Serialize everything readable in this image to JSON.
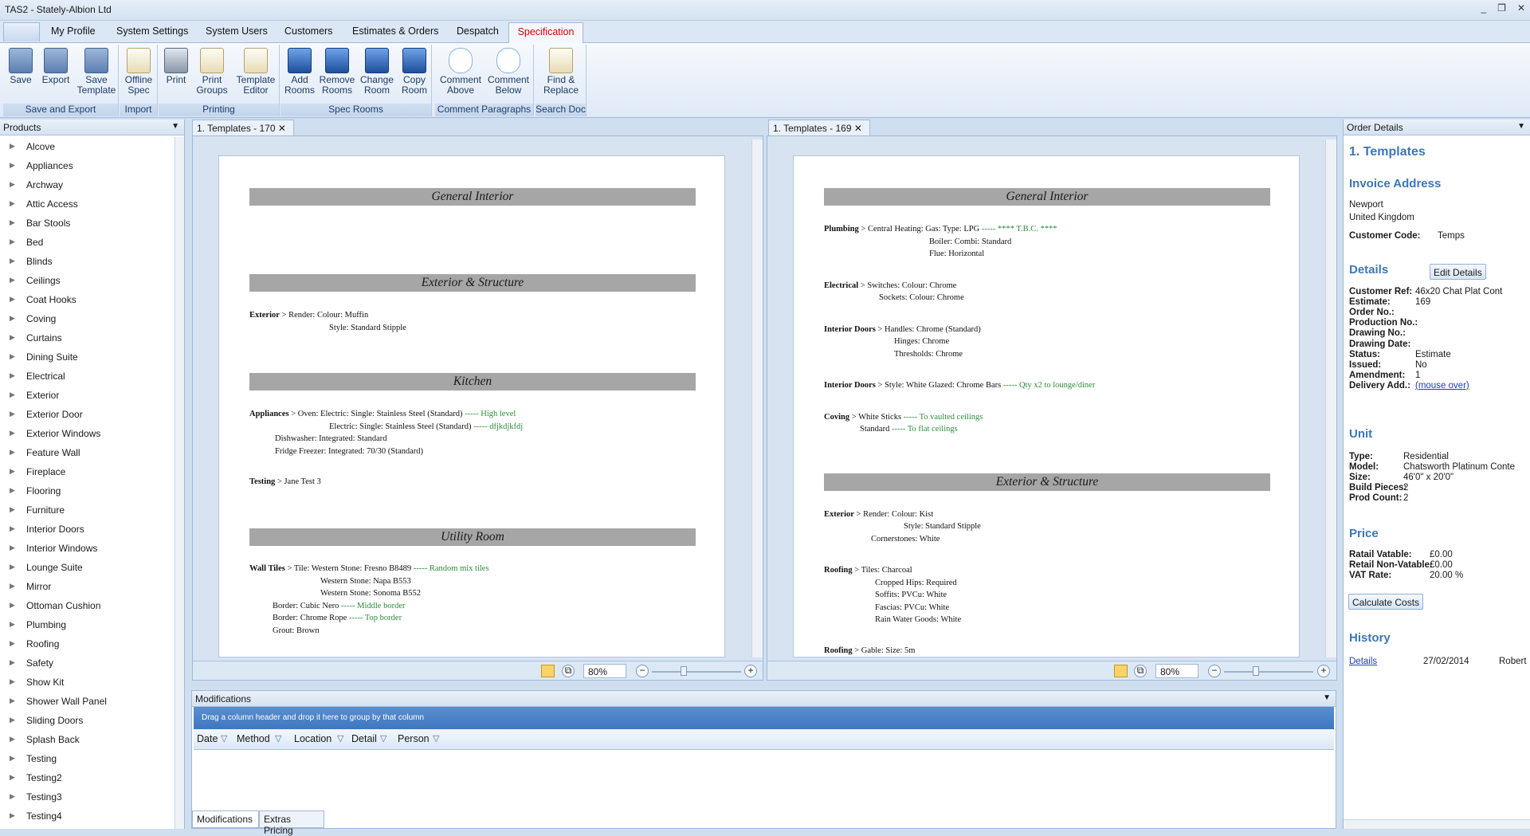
{
  "window": {
    "title": "TAS2 - Stately-Albion Ltd",
    "controls": [
      "_",
      "❐",
      "✕"
    ]
  },
  "menu": {
    "tabs": [
      "My Profile",
      "System Settings",
      "System Users",
      "Customers",
      "Estimates & Orders",
      "Despatch"
    ],
    "active": "Specification"
  },
  "ribbon": {
    "save": "Save",
    "export": "Export",
    "save_template": "Save Template",
    "g_save": "Save and Export",
    "offline_spec": "Offline Spec",
    "g_import": "Import",
    "print": "Print",
    "print_groups": "Print Groups",
    "template_editor": "Template Editor",
    "g_printing": "Printing",
    "add_rooms": "Add Rooms",
    "remove_rooms": "Remove Rooms",
    "change_room": "Change Room",
    "copy_room": "Copy Room",
    "g_spec": "Spec Rooms",
    "comment_above": "Comment Above",
    "comment_below": "Comment Below",
    "g_comment": "Comment Paragraphs",
    "find_replace": "Find & Replace",
    "g_search": "Search Doc"
  },
  "products": {
    "header": "Products",
    "items": [
      "Alcove",
      "Appliances",
      "Archway",
      "Attic Access",
      "Bar Stools",
      "Bed",
      "Blinds",
      "Ceilings",
      "Coat Hooks",
      "Coving",
      "Curtains",
      "Dining Suite",
      "Electrical",
      "Exterior",
      "Exterior Door",
      "Exterior Windows",
      "Feature Wall",
      "Fireplace",
      "Flooring",
      "Furniture",
      "Interior Doors",
      "Interior Windows",
      "Lounge Suite",
      "Mirror",
      "Ottoman Cushion",
      "Plumbing",
      "Roofing",
      "Safety",
      "Show Kit",
      "Shower Wall Panel",
      "Sliding Doors",
      "Splash Back",
      "Testing",
      "Testing2",
      "Testing3",
      "Testing4"
    ]
  },
  "doc1": {
    "tab": "1. Templates - 170",
    "zoom": "80%",
    "s1": "General Interior",
    "s2": "Exterior & Structure",
    "s3": "Kitchen",
    "s4": "Utility Room",
    "ext_label": "Exterior",
    "ext_1": "Render: Colour: Muffin",
    "ext_2": "Style: Standard Stipple",
    "app_label": "Appliances",
    "app_1": "Oven: Electric: Single: Stainless Steel (Standard)",
    "app_1n": "----- High level",
    "app_2": "Electric: Single: Stainless Steel (Standard)",
    "app_2n": "----- dfjkdjkfdj",
    "app_3": "Dishwasher: Integrated: Standard",
    "app_4": "Fridge Freezer: Integrated: 70/30 (Standard)",
    "test_label": "Testing",
    "test_1": "Jane Test 3",
    "wt_label": "Wall Tiles",
    "wt_1": "Tile: Western Stone: Fresno B8489",
    "wt_1n": "----- Random mix tiles",
    "wt_2": "Western Stone: Napa B553",
    "wt_3": "Western Stone: Sonoma B552",
    "wt_4": "Border: Cubic Nero",
    "wt_4n": "----- Middle border",
    "wt_5": "Border: Chrome Rope",
    "wt_5n": "----- Top border",
    "wt_6": "Grout: Brown"
  },
  "doc2": {
    "tab": "1. Templates - 169",
    "zoom": "80%",
    "s1": "General Interior",
    "s2": "Exterior & Structure",
    "pl_label": "Plumbing",
    "pl_1": "Central Heating: Gas: Type: LPG",
    "pl_1n": "----- **** T.B.C. ****",
    "pl_2": "Boiler: Combi: Standard",
    "pl_3": "Flue: Horizontal",
    "el_label": "Electrical",
    "el_1": "Switches: Colour: Chrome",
    "el_2": "Sockets: Colour: Chrome",
    "id_label": "Interior Doors",
    "id_1": "Handles: Chrome (Standard)",
    "id_2": "Hinges: Chrome",
    "id_3": "Thresholds: Chrome",
    "id2_label": "Interior Doors",
    "id2_1": "Style: White Glazed: Chrome Bars",
    "id2_1n": "----- Qty x2 to lounge/diner",
    "cv_label": "Coving",
    "cv_1": "White Sticks",
    "cv_1n": "----- To vaulted ceilings",
    "cv_2": "Standard",
    "cv_2n": "----- To flat ceilings",
    "ex_label": "Exterior",
    "ex_1": "Render: Colour: Kist",
    "ex_2": "Style: Standard Stipple",
    "ex_3": "Cornerstones: White",
    "rf_label": "Roofing",
    "rf_1": "Tiles: Charcoal",
    "rf_2": "Cropped Hips: Required",
    "rf_3": "Soffits: PVCu: White",
    "rf_4": "Fascias: PVCu: White",
    "rf_5": "Rain Water Goods: White",
    "rf2_label": "Roofing",
    "rf2_1": "Gable: Size: 5m"
  },
  "mods": {
    "header": "Modifications",
    "grouping": "Drag a column header and drop it here to group by that column",
    "cols": [
      "Date",
      "Method",
      "Location",
      "Detail",
      "Person"
    ],
    "tabs": [
      "Modifications",
      "Extras Pricing"
    ]
  },
  "order": {
    "header": "Order Details",
    "title": "1. Templates",
    "invoice_h": "Invoice Address",
    "addr1": "Newport",
    "addr2": "United Kingdom",
    "cust_code_l": "Customer Code:",
    "cust_code": "Temps",
    "details_h": "Details",
    "edit_details": "Edit Details",
    "details": [
      [
        "Customer Ref:",
        "46x20 Chat Plat Cont"
      ],
      [
        "Estimate:",
        "169"
      ],
      [
        "Order No.:",
        ""
      ],
      [
        "Production No.:",
        ""
      ],
      [
        "Drawing No.:",
        ""
      ],
      [
        "Drawing Date:",
        ""
      ],
      [
        "Status:",
        "Estimate"
      ],
      [
        "Issued:",
        "No"
      ],
      [
        "Amendment:",
        "1"
      ],
      [
        "Delivery Add.:",
        "(mouse over)"
      ]
    ],
    "unit_h": "Unit",
    "unit": [
      [
        "Type:",
        "Residential"
      ],
      [
        "Model:",
        "Chatsworth Platinum Conte"
      ],
      [
        "Size:",
        "46'0\" x 20'0\""
      ],
      [
        "Build Pieces:",
        "2"
      ],
      [
        "Prod Count:",
        "2"
      ]
    ],
    "price_h": "Price",
    "price": [
      [
        "Ratail Vatable:",
        "£0.00"
      ],
      [
        "Retail Non-Vatable:",
        "£0.00"
      ],
      [
        "VAT Rate:",
        "20.00 %"
      ]
    ],
    "calc": "Calculate Costs",
    "history_h": "History",
    "hist_link": "Details",
    "hist_date": "27/02/2014",
    "hist_person": "Robert"
  },
  "colors": {
    "accent": "#3d76b6",
    "active_tab_text": "#d80000",
    "note_green": "#2e8b3a",
    "section_grey": "#a6a6a6"
  }
}
